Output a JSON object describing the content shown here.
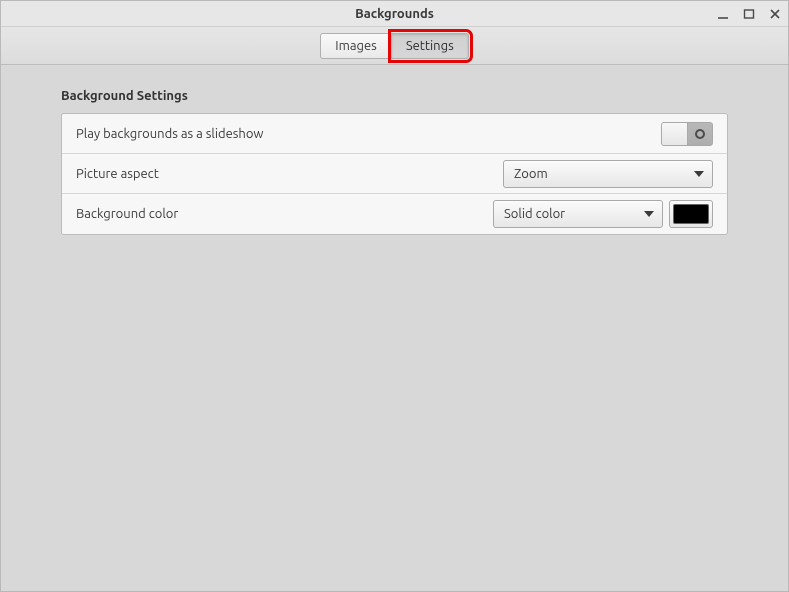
{
  "window": {
    "title": "Backgrounds"
  },
  "tabs": {
    "images": "Images",
    "settings": "Settings"
  },
  "section": {
    "title": "Background Settings"
  },
  "rows": {
    "slideshow": {
      "label": "Play backgrounds as a slideshow",
      "value": false
    },
    "aspect": {
      "label": "Picture aspect",
      "value": "Zoom"
    },
    "bgcolor": {
      "label": "Background color",
      "mode": "Solid color",
      "color": "#000000"
    }
  }
}
